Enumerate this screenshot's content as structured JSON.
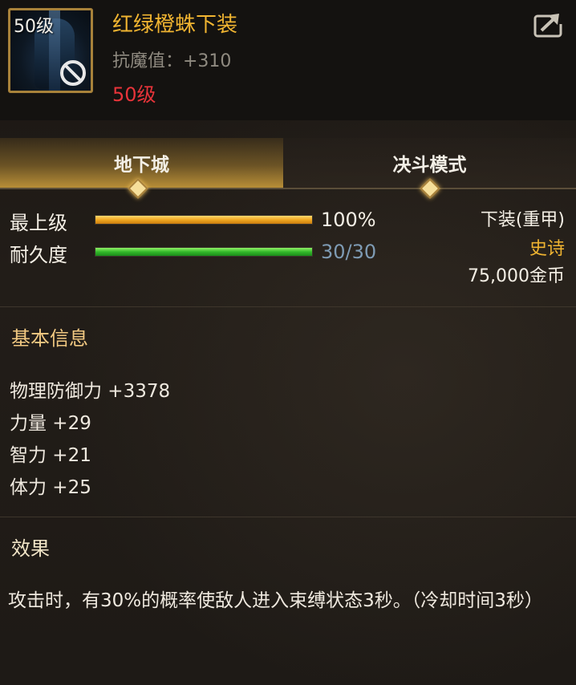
{
  "item": {
    "icon_level": "50级",
    "name": "红绿橙蛛下装",
    "attribute": "抗魔值：+310",
    "level_req": "50级"
  },
  "tabs": [
    {
      "label": "地下城",
      "active": true
    },
    {
      "label": "决斗模式",
      "active": false
    }
  ],
  "stats": {
    "grade": {
      "label": "最上级",
      "value": "100%",
      "fill": 1.0
    },
    "durability": {
      "label": "耐久度",
      "value": "30/30",
      "fill": 1.0
    }
  },
  "info": {
    "type": "下装(重甲)",
    "rarity": "史诗",
    "price": "75,000金币"
  },
  "basic": {
    "title": "基本信息",
    "props": [
      "物理防御力 +3378",
      "力量 +29",
      "智力 +21",
      "体力 +25"
    ]
  },
  "effect": {
    "title": "效果",
    "text": "攻击时，有30%的概率使敌人进入束缚状态3秒。（冷却时间3秒）"
  },
  "colors": {
    "name": "#f0b431",
    "level_req": "#e8343a",
    "rarity": "#f0b431",
    "grade_bar": "#f0a821",
    "durability_bar": "#33b92a"
  },
  "icons": [
    "ban-icon",
    "share-icon",
    "armor-icon"
  ]
}
